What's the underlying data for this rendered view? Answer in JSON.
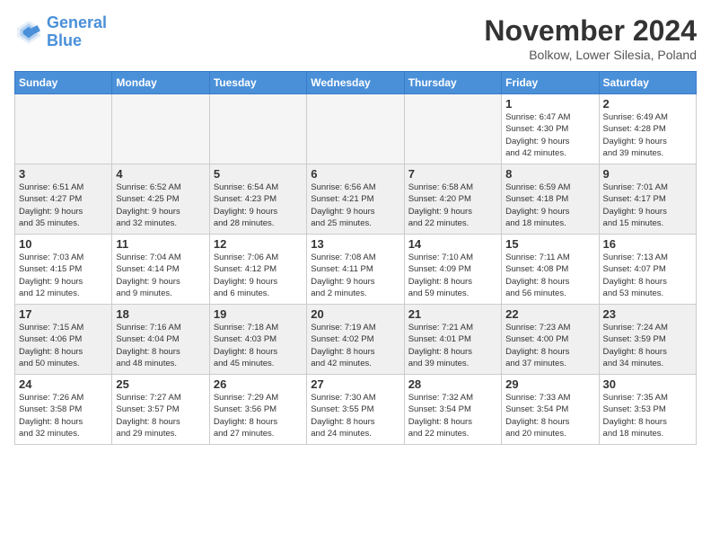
{
  "header": {
    "logo_line1": "General",
    "logo_line2": "Blue",
    "month_title": "November 2024",
    "subtitle": "Bolkow, Lower Silesia, Poland"
  },
  "weekdays": [
    "Sunday",
    "Monday",
    "Tuesday",
    "Wednesday",
    "Thursday",
    "Friday",
    "Saturday"
  ],
  "weeks": [
    [
      {
        "day": "",
        "info": ""
      },
      {
        "day": "",
        "info": ""
      },
      {
        "day": "",
        "info": ""
      },
      {
        "day": "",
        "info": ""
      },
      {
        "day": "",
        "info": ""
      },
      {
        "day": "1",
        "info": "Sunrise: 6:47 AM\nSunset: 4:30 PM\nDaylight: 9 hours\nand 42 minutes."
      },
      {
        "day": "2",
        "info": "Sunrise: 6:49 AM\nSunset: 4:28 PM\nDaylight: 9 hours\nand 39 minutes."
      }
    ],
    [
      {
        "day": "3",
        "info": "Sunrise: 6:51 AM\nSunset: 4:27 PM\nDaylight: 9 hours\nand 35 minutes."
      },
      {
        "day": "4",
        "info": "Sunrise: 6:52 AM\nSunset: 4:25 PM\nDaylight: 9 hours\nand 32 minutes."
      },
      {
        "day": "5",
        "info": "Sunrise: 6:54 AM\nSunset: 4:23 PM\nDaylight: 9 hours\nand 28 minutes."
      },
      {
        "day": "6",
        "info": "Sunrise: 6:56 AM\nSunset: 4:21 PM\nDaylight: 9 hours\nand 25 minutes."
      },
      {
        "day": "7",
        "info": "Sunrise: 6:58 AM\nSunset: 4:20 PM\nDaylight: 9 hours\nand 22 minutes."
      },
      {
        "day": "8",
        "info": "Sunrise: 6:59 AM\nSunset: 4:18 PM\nDaylight: 9 hours\nand 18 minutes."
      },
      {
        "day": "9",
        "info": "Sunrise: 7:01 AM\nSunset: 4:17 PM\nDaylight: 9 hours\nand 15 minutes."
      }
    ],
    [
      {
        "day": "10",
        "info": "Sunrise: 7:03 AM\nSunset: 4:15 PM\nDaylight: 9 hours\nand 12 minutes."
      },
      {
        "day": "11",
        "info": "Sunrise: 7:04 AM\nSunset: 4:14 PM\nDaylight: 9 hours\nand 9 minutes."
      },
      {
        "day": "12",
        "info": "Sunrise: 7:06 AM\nSunset: 4:12 PM\nDaylight: 9 hours\nand 6 minutes."
      },
      {
        "day": "13",
        "info": "Sunrise: 7:08 AM\nSunset: 4:11 PM\nDaylight: 9 hours\nand 2 minutes."
      },
      {
        "day": "14",
        "info": "Sunrise: 7:10 AM\nSunset: 4:09 PM\nDaylight: 8 hours\nand 59 minutes."
      },
      {
        "day": "15",
        "info": "Sunrise: 7:11 AM\nSunset: 4:08 PM\nDaylight: 8 hours\nand 56 minutes."
      },
      {
        "day": "16",
        "info": "Sunrise: 7:13 AM\nSunset: 4:07 PM\nDaylight: 8 hours\nand 53 minutes."
      }
    ],
    [
      {
        "day": "17",
        "info": "Sunrise: 7:15 AM\nSunset: 4:06 PM\nDaylight: 8 hours\nand 50 minutes."
      },
      {
        "day": "18",
        "info": "Sunrise: 7:16 AM\nSunset: 4:04 PM\nDaylight: 8 hours\nand 48 minutes."
      },
      {
        "day": "19",
        "info": "Sunrise: 7:18 AM\nSunset: 4:03 PM\nDaylight: 8 hours\nand 45 minutes."
      },
      {
        "day": "20",
        "info": "Sunrise: 7:19 AM\nSunset: 4:02 PM\nDaylight: 8 hours\nand 42 minutes."
      },
      {
        "day": "21",
        "info": "Sunrise: 7:21 AM\nSunset: 4:01 PM\nDaylight: 8 hours\nand 39 minutes."
      },
      {
        "day": "22",
        "info": "Sunrise: 7:23 AM\nSunset: 4:00 PM\nDaylight: 8 hours\nand 37 minutes."
      },
      {
        "day": "23",
        "info": "Sunrise: 7:24 AM\nSunset: 3:59 PM\nDaylight: 8 hours\nand 34 minutes."
      }
    ],
    [
      {
        "day": "24",
        "info": "Sunrise: 7:26 AM\nSunset: 3:58 PM\nDaylight: 8 hours\nand 32 minutes."
      },
      {
        "day": "25",
        "info": "Sunrise: 7:27 AM\nSunset: 3:57 PM\nDaylight: 8 hours\nand 29 minutes."
      },
      {
        "day": "26",
        "info": "Sunrise: 7:29 AM\nSunset: 3:56 PM\nDaylight: 8 hours\nand 27 minutes."
      },
      {
        "day": "27",
        "info": "Sunrise: 7:30 AM\nSunset: 3:55 PM\nDaylight: 8 hours\nand 24 minutes."
      },
      {
        "day": "28",
        "info": "Sunrise: 7:32 AM\nSunset: 3:54 PM\nDaylight: 8 hours\nand 22 minutes."
      },
      {
        "day": "29",
        "info": "Sunrise: 7:33 AM\nSunset: 3:54 PM\nDaylight: 8 hours\nand 20 minutes."
      },
      {
        "day": "30",
        "info": "Sunrise: 7:35 AM\nSunset: 3:53 PM\nDaylight: 8 hours\nand 18 minutes."
      }
    ]
  ]
}
